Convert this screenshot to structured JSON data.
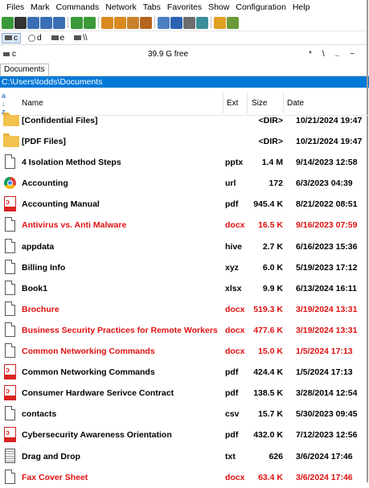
{
  "menu": [
    "Files",
    "Mark",
    "Commands",
    "Network",
    "Tabs",
    "Favorites",
    "Show",
    "Configuration",
    "Help"
  ],
  "toolbar_icons": [
    "refresh-icon",
    "terminal-icon",
    "network-icon",
    "thumbnails-icon",
    "details-icon",
    "back-icon",
    "forward-icon",
    "pack-icon",
    "unpack-icon",
    "ftp-icon",
    "ftp-disconnect-icon",
    "find-icon",
    "multi-rename-icon",
    "sync-dirs-icon",
    "notepad-icon",
    "archive-icon",
    "copy-names-icon"
  ],
  "drives": [
    {
      "letter": "c",
      "active": true
    },
    {
      "letter": "d",
      "active": false
    },
    {
      "letter": "e",
      "active": false
    },
    {
      "letter": "\\\\",
      "active": false
    }
  ],
  "panel": {
    "drive_label": "c",
    "free_space": "39.9 G free",
    "nav_buttons": [
      "*",
      "\\",
      "..",
      "~"
    ]
  },
  "tab": {
    "label": "Documents"
  },
  "path": "C:\\Users\\todds\\Documents",
  "columns": {
    "name": "Name",
    "ext": "Ext",
    "size": "Size",
    "date": "Date"
  },
  "files": [
    {
      "icon": "folder-icon",
      "name": "[Confidential Files]",
      "ext": "",
      "size": "<DIR>",
      "date": "10/21/2024 19:47",
      "red": false
    },
    {
      "icon": "folder-icon",
      "name": "[PDF Files]",
      "ext": "",
      "size": "<DIR>",
      "date": "10/21/2024 19:47",
      "red": false
    },
    {
      "icon": "file-icon",
      "name": "4 Isolation Method Steps",
      "ext": "pptx",
      "size": "1.4 M",
      "date": "9/14/2023 12:58",
      "red": false
    },
    {
      "icon": "chrome-icon",
      "name": "Accounting",
      "ext": "url",
      "size": "172",
      "date": "6/3/2023 04:39",
      "red": false
    },
    {
      "icon": "pdf-icon",
      "name": "Accounting Manual",
      "ext": "pdf",
      "size": "945.4 K",
      "date": "8/21/2022 08:51",
      "red": false
    },
    {
      "icon": "file-icon",
      "name": "Antivirus vs. Anti Malware",
      "ext": "docx",
      "size": "16.5 K",
      "date": "9/16/2023 07:59",
      "red": true
    },
    {
      "icon": "file-icon",
      "name": "appdata",
      "ext": "hive",
      "size": "2.7 K",
      "date": "6/16/2023 15:36",
      "red": false
    },
    {
      "icon": "file-icon",
      "name": "Billing Info",
      "ext": "xyz",
      "size": "6.0 K",
      "date": "5/19/2023 17:12",
      "red": false
    },
    {
      "icon": "file-icon",
      "name": "Book1",
      "ext": "xlsx",
      "size": "9.9 K",
      "date": "6/13/2024 16:11",
      "red": false
    },
    {
      "icon": "file-icon",
      "name": "Brochure",
      "ext": "docx",
      "size": "519.3 K",
      "date": "3/19/2024 13:31",
      "red": true
    },
    {
      "icon": "file-icon",
      "name": "Business Security Practices for Remote Workers",
      "ext": "docx",
      "size": "477.6 K",
      "date": "3/19/2024 13:31",
      "red": true
    },
    {
      "icon": "file-icon",
      "name": "Common Networking Commands",
      "ext": "docx",
      "size": "15.0 K",
      "date": "1/5/2024 17:13",
      "red": true
    },
    {
      "icon": "pdf-icon",
      "name": "Common Networking Commands",
      "ext": "pdf",
      "size": "424.4 K",
      "date": "1/5/2024 17:13",
      "red": false
    },
    {
      "icon": "pdf-icon",
      "name": "Consumer Hardware Serivce Contract",
      "ext": "pdf",
      "size": "138.5 K",
      "date": "3/28/2014 12:54",
      "red": false
    },
    {
      "icon": "file-icon",
      "name": "contacts",
      "ext": "csv",
      "size": "15.7 K",
      "date": "5/30/2023 09:45",
      "red": false
    },
    {
      "icon": "pdf-icon",
      "name": "Cybersecurity Awareness Orientation",
      "ext": "pdf",
      "size": "432.0 K",
      "date": "7/12/2023 12:56",
      "red": false
    },
    {
      "icon": "text-file-icon",
      "name": "Drag and Drop",
      "ext": "txt",
      "size": "626",
      "date": "3/6/2024 17:46",
      "red": false
    },
    {
      "icon": "file-icon",
      "name": "Fax Cover Sheet",
      "ext": "docx",
      "size": "63.4 K",
      "date": "3/6/2024 17:46",
      "red": true
    }
  ],
  "colors": {
    "path_bg": "#0078d7",
    "red_text": "#e01010",
    "folder": "#f2c14e"
  }
}
